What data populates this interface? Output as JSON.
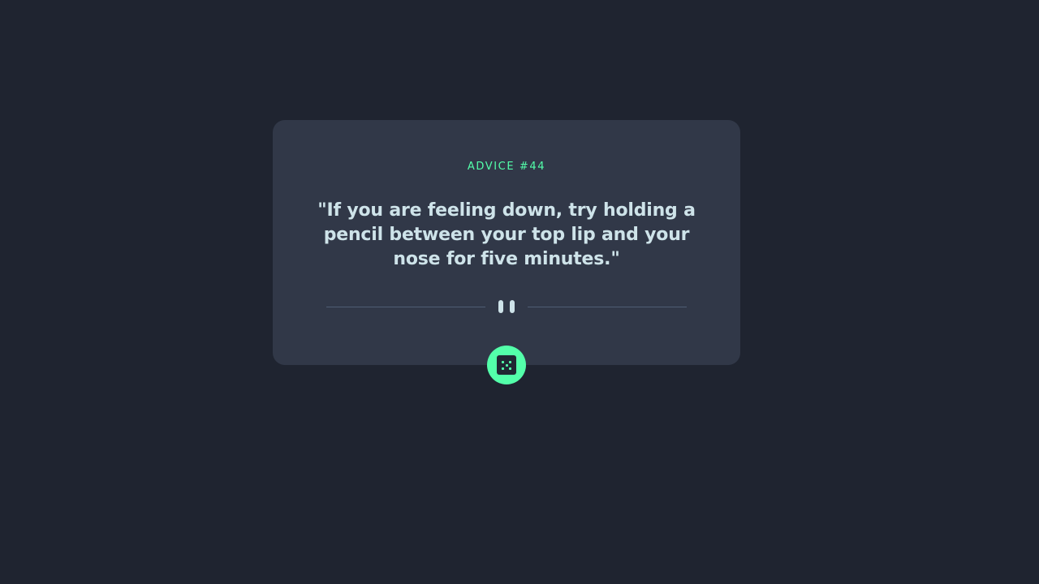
{
  "advice": {
    "id_label": "ADVICE #44",
    "text": "\"If you are feeling down, try holding a pencil between your top lip and your nose for five minutes.\""
  },
  "divider": {
    "icon": "pause-icon"
  },
  "dice_button": {
    "icon": "dice-icon"
  },
  "colors": {
    "background": "#1f2430",
    "card": "#313848",
    "accent": "#53ffaa",
    "text": "#cee3e9",
    "divider": "#4f5d74"
  }
}
